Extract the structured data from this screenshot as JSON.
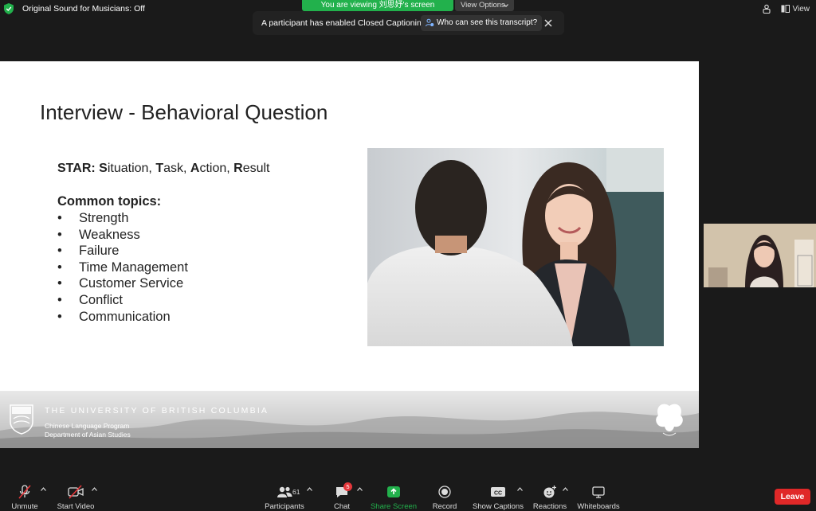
{
  "topbar": {
    "original_sound": "Original Sound for Musicians: Off",
    "viewing_label": "You are viewing 刘思妤's screen",
    "view_options_label": "View Options",
    "view_label": "View"
  },
  "cc_banner": {
    "message": "A participant has enabled Closed Captioning",
    "who_button": "Who can see this transcript?"
  },
  "slide": {
    "title": "Interview - Behavioral Question",
    "star_bold": "STAR:",
    "star_S": "S",
    "star_rest1": "ituation, ",
    "star_T": "T",
    "star_rest2": "ask, ",
    "star_A": "A",
    "star_rest3": "ction, ",
    "star_R": "R",
    "star_rest4": "esult",
    "topics_heading": "Common topics:",
    "topics": [
      "Strength",
      "Weakness",
      "Failure",
      "Time Management",
      "Customer Service",
      "Conflict",
      "Communication"
    ],
    "footer": {
      "university": "THE UNIVERSITY OF BRITISH COLUMBIA",
      "program": "Chinese Language Program",
      "department": "Department of Asian Studies"
    }
  },
  "toolbar": {
    "unmute": "Unmute",
    "start_video": "Start Video",
    "participants": "Participants",
    "participants_count": "61",
    "chat": "Chat",
    "chat_badge": "5",
    "share_screen": "Share Screen",
    "record": "Record",
    "show_captions": "Show Captions",
    "reactions": "Reactions",
    "whiteboards": "Whiteboards",
    "leave": "Leave"
  },
  "colors": {
    "share_green": "#22b14c",
    "leave_red": "#e02828",
    "badge_red": "#e5373b",
    "background": "#1a1a1a"
  }
}
